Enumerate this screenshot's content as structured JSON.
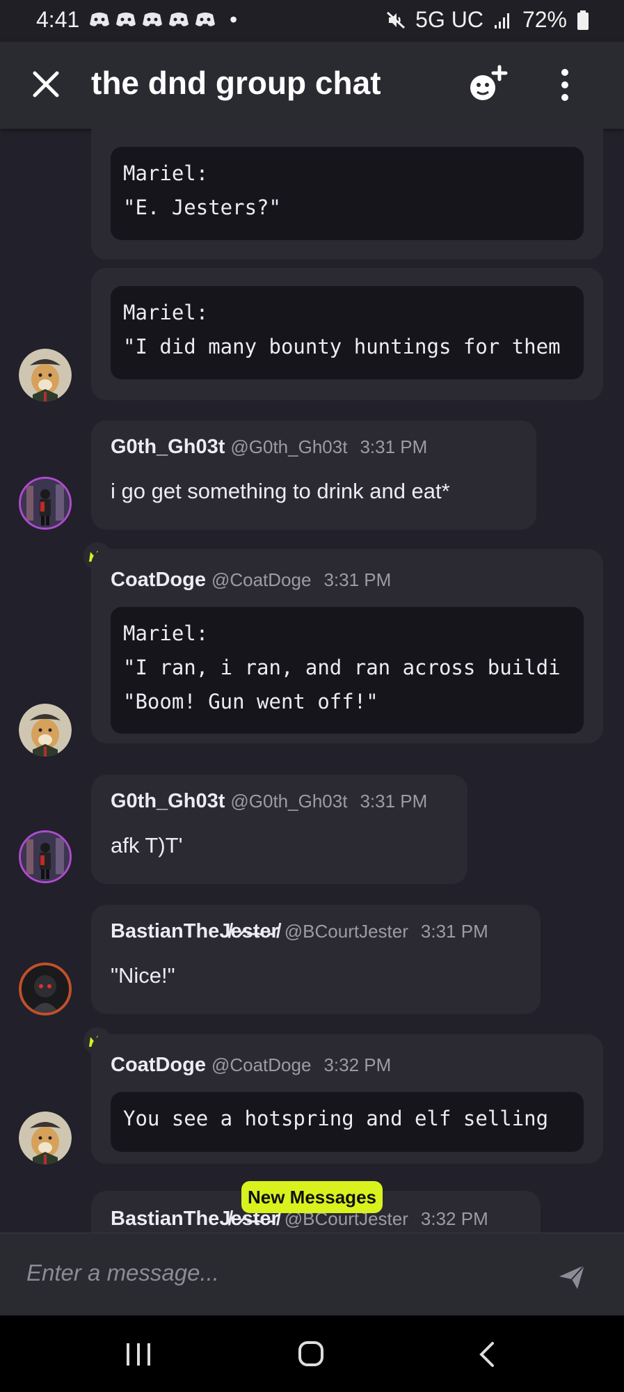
{
  "status_bar": {
    "time": "4:41",
    "dot": "•",
    "network": "5G UC",
    "battery": "72%",
    "icons": [
      "discord-icon",
      "discord-icon",
      "discord-icon",
      "discord-icon",
      "discord-icon",
      "mute-icon",
      "signal-icon",
      "battery-icon"
    ]
  },
  "header": {
    "title": "the dnd group chat",
    "icons": [
      "close-icon",
      "add-member-icon",
      "more-vertical-icon"
    ]
  },
  "messages": [
    {
      "code": "Mariel:\n\"E. Jesters?\""
    },
    {
      "code": "Mariel:\n\"I did many bounty huntings for them"
    },
    {
      "name": "G0th_Gh03t",
      "handle": "@G0th_Gh03t",
      "time": "3:31 PM",
      "text": "i go get something to drink and eat*"
    },
    {
      "name": "CoatDoge",
      "handle": "@CoatDoge",
      "time": "3:31 PM",
      "code": "Mariel:\n\"I ran, i ran, and ran across buildi\n\"Boom! Gun went off!\""
    },
    {
      "name": "G0th_Gh03t",
      "handle": "@G0th_Gh03t",
      "time": "3:31 PM",
      "text": "afk T)T'"
    },
    {
      "name": "BastianTheJ̸e̷s̶t̴e̵r̸",
      "handle": "@BCourtJester",
      "time": "3:31 PM",
      "text": "\"Nice!\""
    },
    {
      "name": "CoatDoge",
      "handle": "@CoatDoge",
      "time": "3:32 PM",
      "code": "You see a hotspring and elf selling"
    },
    {
      "name": "BastianTheJ̸e̷s̶t̴e̵r̸",
      "handle": "@BCourtJester",
      "time": "3:32 PM"
    }
  ],
  "new_messages_label": "New Messages",
  "composer": {
    "placeholder": "Enter a message...",
    "send_icon": "send-icon"
  },
  "nav_bar": {
    "icons": [
      "recents-icon",
      "home-icon",
      "back-icon"
    ]
  }
}
